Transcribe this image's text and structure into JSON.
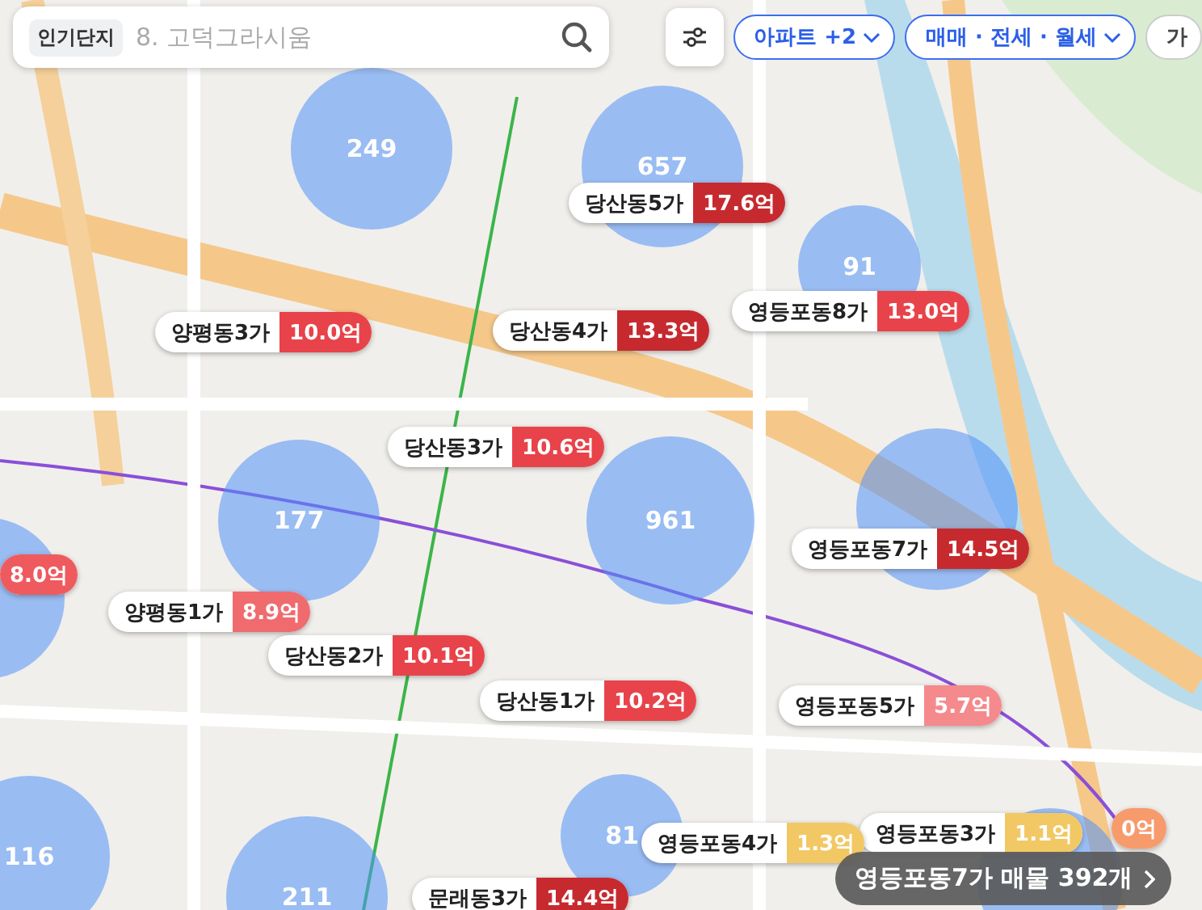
{
  "search": {
    "chip": "인기단지",
    "placeholder": "8. 고덕그라시움"
  },
  "filters": [
    {
      "label": "아파트 +2",
      "active": true
    },
    {
      "label": "매매 · 전세 · 월세",
      "active": true
    },
    {
      "label": "가",
      "active": false
    }
  ],
  "clusters": [
    {
      "count": "249"
    },
    {
      "count": "657"
    },
    {
      "count": "91"
    },
    {
      "count": "177"
    },
    {
      "count": "961"
    },
    {
      "count": "116"
    },
    {
      "count": "211"
    },
    {
      "count": "81"
    }
  ],
  "markers": [
    {
      "name": "당산동5가",
      "price": "17.6억",
      "color": "#c62a2f"
    },
    {
      "name": "영등포동8가",
      "price": "13.0억",
      "color": "#e8434a"
    },
    {
      "name": "양평동3가",
      "price": "10.0억",
      "color": "#e8434a"
    },
    {
      "name": "당산동4가",
      "price": "13.3억",
      "color": "#c62a2f"
    },
    {
      "name": "당산동3가",
      "price": "10.6억",
      "color": "#e8434a"
    },
    {
      "name": "영등포동7가",
      "price": "14.5억",
      "color": "#c62a2f"
    },
    {
      "price": "8.0억",
      "color": "#ef5a5f"
    },
    {
      "name": "양평동1가",
      "price": "8.9억",
      "color": "#f06b6e"
    },
    {
      "name": "당산동2가",
      "price": "10.1억",
      "color": "#e8434a"
    },
    {
      "name": "당산동1가",
      "price": "10.2억",
      "color": "#e8434a"
    },
    {
      "name": "영등포동5가",
      "price": "5.7억",
      "color": "#f58a8c"
    },
    {
      "name": "영등포동3가",
      "price": "1.1억",
      "color": "#f2c865"
    },
    {
      "name": "영등포동4가",
      "price": "1.3억",
      "color": "#f2c865"
    },
    {
      "name": "문래동3가",
      "price": "14.4억",
      "color": "#c62a2f"
    },
    {
      "price": "0억",
      "color": "#f79a6c"
    }
  ],
  "summary": {
    "label": "영등포동7가 매물 392개"
  }
}
